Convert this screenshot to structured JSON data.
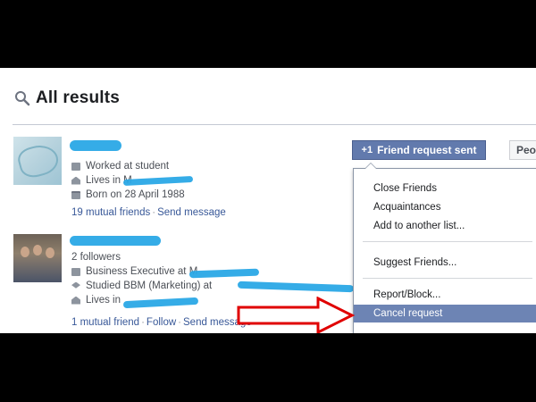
{
  "header": {
    "title": "All results",
    "icon": "magnifier-icon"
  },
  "results": [
    {
      "details": [
        {
          "icon": "briefcase-icon",
          "text": "Worked at student"
        },
        {
          "icon": "home-icon",
          "text": "Lives in M"
        },
        {
          "icon": "calendar-icon",
          "text": "Born on 28 April 1988"
        }
      ],
      "links": {
        "mutual": "19 mutual friends",
        "sep": "·",
        "message": "Send message"
      }
    },
    {
      "followers": "2 followers",
      "details": [
        {
          "icon": "briefcase-icon",
          "text": "Business Executive at M"
        },
        {
          "icon": "graduation-cap-icon",
          "text": "Studied BBM (Marketing) at"
        },
        {
          "icon": "home-icon",
          "text": "Lives in"
        }
      ],
      "links": {
        "mutual": "1 mutual friend",
        "sep": "·",
        "follow": "Follow",
        "sep2": "·",
        "message": "Send message"
      }
    }
  ],
  "buttons": {
    "friend_request_sent": "Friend request sent",
    "friend_request_icon": "+1",
    "people": "Peo"
  },
  "menu": {
    "items": [
      "Close Friends",
      "Acquaintances",
      "Add to another list...",
      "Suggest Friends...",
      "Report/Block...",
      "Cancel request"
    ],
    "selected": "Cancel request"
  },
  "colors": {
    "accent": "#627aad",
    "link": "#385898",
    "redaction": "#2aa8e6",
    "arrow": "#e00000"
  }
}
